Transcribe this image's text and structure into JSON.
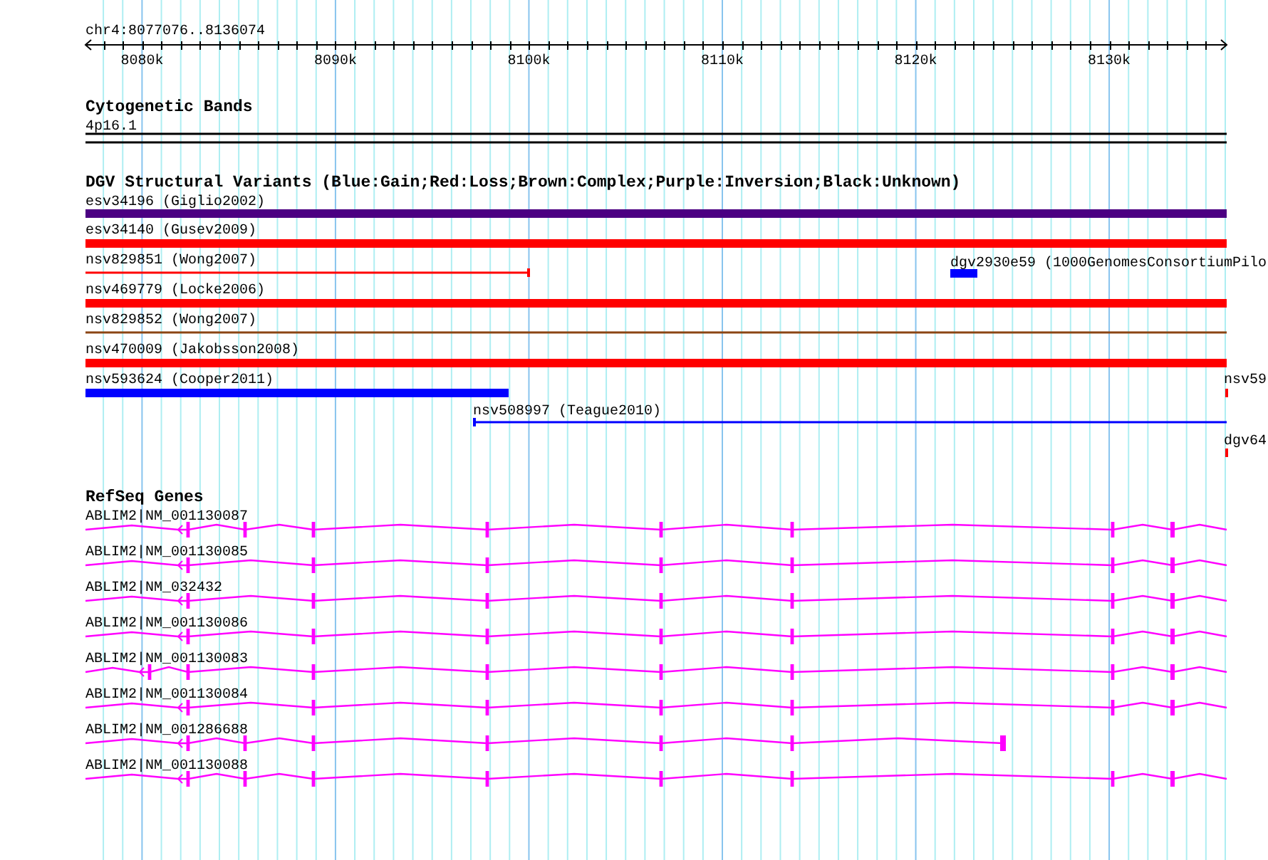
{
  "ruler": {
    "region": "chr4:8077076..8136074",
    "ticks": [
      "8080k",
      "8090k",
      "8100k",
      "8110k",
      "8120k",
      "8130k"
    ]
  },
  "tracks": [
    {
      "kind": "bands",
      "title": "Cytogenetic Bands",
      "features": [
        {
          "label": "4p16.1"
        }
      ]
    },
    {
      "kind": "variants",
      "title": "DGV Structural Variants (Blue:Gain;Red:Loss;Brown:Complex;Purple:Inversion;Black:Unknown)",
      "features": [
        {
          "label": "esv34196 (Giglio2002)",
          "kind": "bar",
          "color": "#4b0082"
        },
        {
          "label": "esv34140 (Gusev2009)",
          "kind": "bar",
          "color": "#ff0000"
        },
        {
          "label": "nsv829851 (Wong2007)",
          "kind": "line",
          "color": "#ff0000"
        },
        {
          "label": "dgv2930e59 (1000GenomesConsortiumPilo",
          "kind": "bar",
          "color": "#0000ff"
        },
        {
          "label": "nsv469779 (Locke2006)",
          "kind": "bar",
          "color": "#ff0000"
        },
        {
          "label": "nsv829852 (Wong2007)",
          "kind": "line",
          "color": "#8b4513"
        },
        {
          "label": "nsv470009 (Jakobsson2008)",
          "kind": "bar",
          "color": "#ff0000"
        },
        {
          "label": "nsv593624 (Cooper2011)",
          "kind": "bar",
          "color": "#0000ff"
        },
        {
          "label": "nsv59",
          "kind": "bar",
          "color": "#ff0000"
        },
        {
          "label": "nsv508997 (Teague2010)",
          "kind": "line",
          "color": "#0000ff"
        },
        {
          "label": "dgv64",
          "kind": "bar",
          "color": "#ff0000"
        }
      ]
    },
    {
      "kind": "genes",
      "title": "RefSeq Genes",
      "features": [
        {
          "label": "ABLIM2|NM_001130087"
        },
        {
          "label": "ABLIM2|NM_001130085"
        },
        {
          "label": "ABLIM2|NM_032432"
        },
        {
          "label": "ABLIM2|NM_001130086"
        },
        {
          "label": "ABLIM2|NM_001130083"
        },
        {
          "label": "ABLIM2|NM_001130084"
        },
        {
          "label": "ABLIM2|NM_001286688"
        },
        {
          "label": "ABLIM2|NM_001130088"
        }
      ]
    }
  ]
}
